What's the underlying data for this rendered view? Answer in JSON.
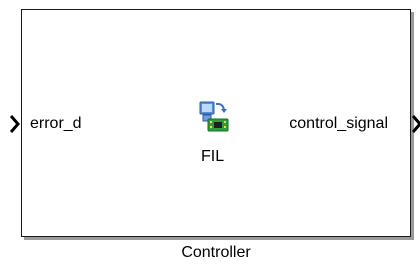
{
  "block": {
    "name": "Controller",
    "mask_label": "FIL",
    "icon": "fpga-board-icon",
    "input_ports": [
      {
        "label": "error_d"
      }
    ],
    "output_ports": [
      {
        "label": "control_signal"
      }
    ]
  }
}
